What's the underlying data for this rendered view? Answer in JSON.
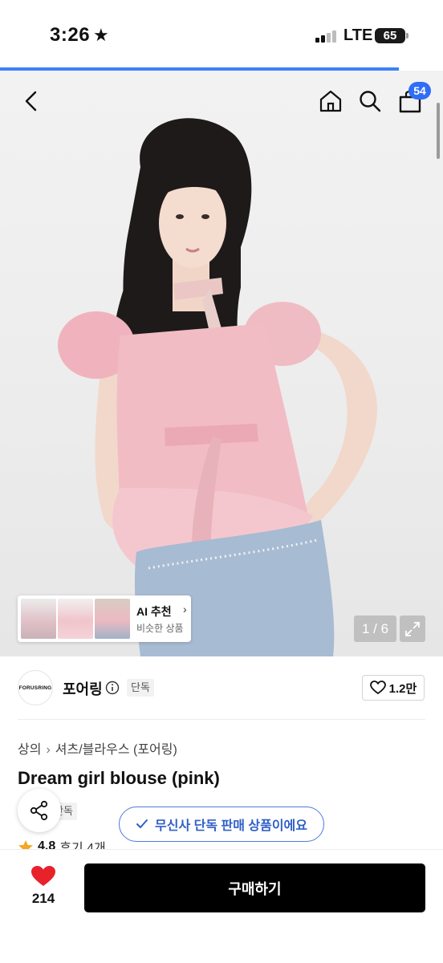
{
  "status_bar": {
    "time": "3:26",
    "focus_icon": "star-icon",
    "network": "LTE",
    "battery": "65"
  },
  "header": {
    "back_icon": "chevron-left-icon",
    "home_icon": "home-icon",
    "search_icon": "search-icon",
    "cart_icon": "shopping-bag-icon",
    "cart_count": "54"
  },
  "gallery": {
    "counter": "1 / 6",
    "progress_fraction": 0.9,
    "expand_icon": "expand-icon"
  },
  "ai_recommend": {
    "title": "AI 추천",
    "subtitle": "비슷한 상품",
    "thumbnail_count": 3
  },
  "brand": {
    "logo_text": "FORUSRING",
    "name": "포어링",
    "exclusive_label": "단독",
    "like_count": "1.2만"
  },
  "product": {
    "breadcrumb": [
      "상의",
      "셔츠/블라우스 (포어링)"
    ],
    "title": "Dream girl blouse (pink)",
    "exclusive_label": "단독",
    "rating": "4.8",
    "reviews": "후기 4개"
  },
  "notice": {
    "text": "무신사 단독 판매 상품이에요"
  },
  "bottom_bar": {
    "like_count": "214",
    "buy_label": "구매하기"
  },
  "colors": {
    "accent_blue": "#2f6df6",
    "heart_red": "#e8222a",
    "star_orange": "#f5a623",
    "buy_button": "#000000",
    "blouse_pink": "#f0b9c2"
  }
}
